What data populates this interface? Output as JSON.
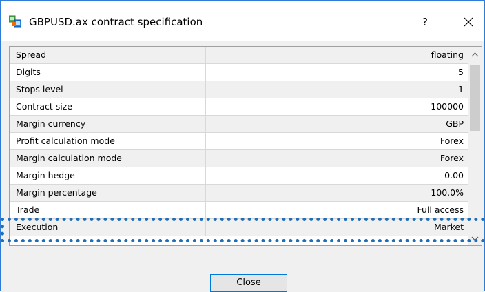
{
  "window": {
    "title": "GBPUSD.ax contract specification",
    "help_label": "?",
    "accent_color": "#2e7cd6"
  },
  "icons": {
    "app": "application-icon",
    "close": "close-icon",
    "scroll_up": "chevron-up-icon",
    "scroll_down": "chevron-down-icon"
  },
  "spec_rows": [
    {
      "name": "Spread",
      "value": "floating"
    },
    {
      "name": "Digits",
      "value": "5"
    },
    {
      "name": "Stops level",
      "value": "1"
    },
    {
      "name": "Contract size",
      "value": "100000"
    },
    {
      "name": "Margin currency",
      "value": "GBP"
    },
    {
      "name": "Profit calculation mode",
      "value": "Forex"
    },
    {
      "name": "Margin calculation mode",
      "value": "Forex"
    },
    {
      "name": "Margin hedge",
      "value": "0.00"
    },
    {
      "name": "Margin percentage",
      "value": "100.0%"
    },
    {
      "name": "Trade",
      "value": "Full access",
      "highlighted": true
    },
    {
      "name": "Execution",
      "value": "Market"
    }
  ],
  "footer": {
    "close_label": "Close"
  }
}
